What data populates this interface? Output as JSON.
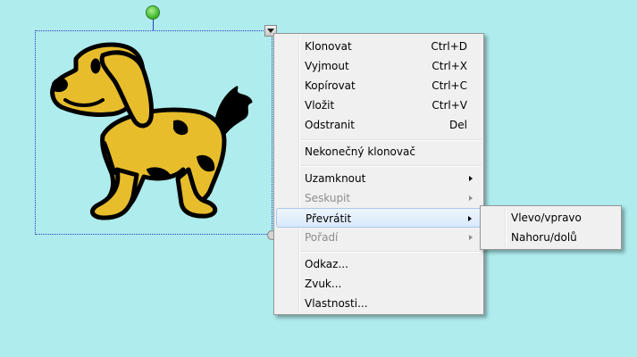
{
  "context_menu": {
    "items": [
      {
        "label": "Klonovat",
        "shortcut": "Ctrl+D"
      },
      {
        "label": "Vyjmout",
        "shortcut": "Ctrl+X"
      },
      {
        "label": "Kopírovat",
        "shortcut": "Ctrl+C"
      },
      {
        "label": "Vložit",
        "shortcut": "Ctrl+V"
      },
      {
        "label": "Odstranit",
        "shortcut": "Del"
      },
      {
        "label": "Nekonečný klonovač"
      },
      {
        "label": "Uzamknout"
      },
      {
        "label": "Seskupit"
      },
      {
        "label": "Převrátit"
      },
      {
        "label": "Pořadí"
      },
      {
        "label": "Odkaz..."
      },
      {
        "label": "Zvuk..."
      },
      {
        "label": "Vlastnosti..."
      }
    ]
  },
  "submenu": {
    "items": [
      {
        "label": "Vlevo/vpravo"
      },
      {
        "label": "Nahoru/dolů"
      }
    ]
  },
  "icons": {
    "rotate_handle": "green-rotate-handle",
    "resize_handle": "resize-handle",
    "menu_arrow": "dropdown-arrow-icon",
    "image": "dog-clipart"
  },
  "colors": {
    "background": "#aeecee",
    "dog_fill": "#e8bd2c",
    "selection_border": "#2a3cbf",
    "menu_bg": "#f0f0f0"
  }
}
